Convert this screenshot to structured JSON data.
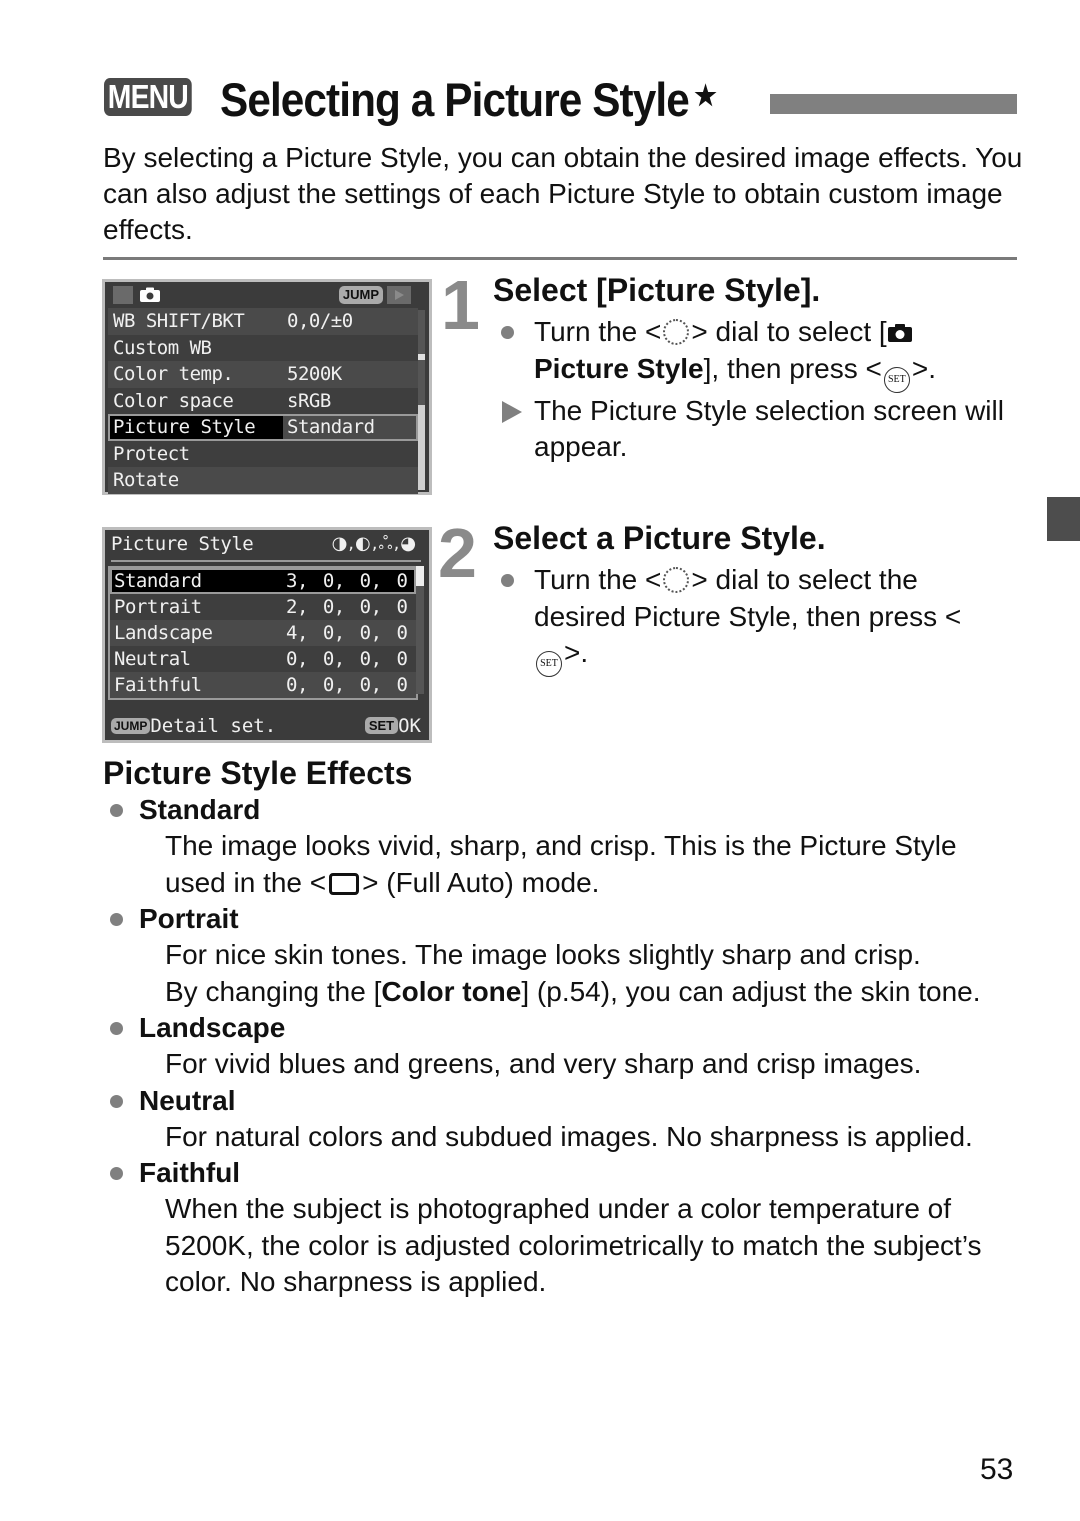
{
  "header": {
    "menu_badge": "MENU",
    "title": "Selecting a Picture Style",
    "title_mark": "★"
  },
  "intro": "By selecting a Picture Style, you can obtain the desired image effects. You can also adjust the settings of each Picture Style to obtain custom image effects.",
  "screen1": {
    "jump_label": "JUMP",
    "rows": [
      {
        "label": "WB SHIFT/BKT",
        "value": "0,0/±0"
      },
      {
        "label": "Custom WB",
        "value": ""
      },
      {
        "label": "Color temp.",
        "value": "5200K"
      },
      {
        "label": "Color space",
        "value": "sRGB"
      },
      {
        "label": "Picture Style",
        "value": "Standard",
        "selected": true
      },
      {
        "label": "Protect",
        "value": ""
      },
      {
        "label": "Rotate",
        "value": ""
      }
    ]
  },
  "screen2": {
    "title": "Picture Style",
    "param_icons": "◑,◐,ஃ,◕",
    "rows": [
      {
        "label": "Standard",
        "value": "3, 0, 0, 0",
        "selected": true
      },
      {
        "label": "Portrait",
        "value": "2, 0, 0, 0"
      },
      {
        "label": "Landscape",
        "value": "4, 0, 0, 0"
      },
      {
        "label": "Neutral",
        "value": "0, 0, 0, 0"
      },
      {
        "label": "Faithful",
        "value": "0, 0, 0, 0"
      }
    ],
    "footer_jump": "JUMP",
    "footer_left": "Detail set.",
    "footer_set": "SET",
    "footer_right": "OK"
  },
  "steps": [
    {
      "number": "1",
      "title": "Select [Picture Style].",
      "b1_pre": "Turn the <",
      "b1_mid": "> dial to select [",
      "b1_bold": "Picture Style",
      "b1_post": "], then press <",
      "b1_end": ">.",
      "b2": "The Picture Style selection screen will appear."
    },
    {
      "number": "2",
      "title": "Select a Picture Style.",
      "b1_pre": "Turn the <",
      "b1_mid": "> dial to select the desired Picture Style, then press <",
      "b1_end": ">."
    }
  ],
  "set_icon": "SET",
  "effects": {
    "title": "Picture Style Effects",
    "items": [
      {
        "name": "Standard",
        "desc_pre": "The image looks vivid, sharp, and crisp. This is the Picture Style used in the <",
        "desc_post": "> (Full Auto) mode."
      },
      {
        "name": "Portrait",
        "desc1": "For nice skin tones. The image looks slightly sharp and crisp.",
        "desc2_pre": "By changing the [",
        "desc2_bold": "Color tone",
        "desc2_post": "] (p.54), you can adjust the skin tone."
      },
      {
        "name": "Landscape",
        "desc": "For vivid blues and greens, and very sharp and crisp images."
      },
      {
        "name": "Neutral",
        "desc": "For natural colors and subdued images. No sharpness is applied."
      },
      {
        "name": "Faithful",
        "desc": "When the subject is photographed under a color temperature of 5200K, the color is adjusted colorimetrically to match the subject’s color. No sharpness is applied."
      }
    ]
  },
  "page_number": "53"
}
